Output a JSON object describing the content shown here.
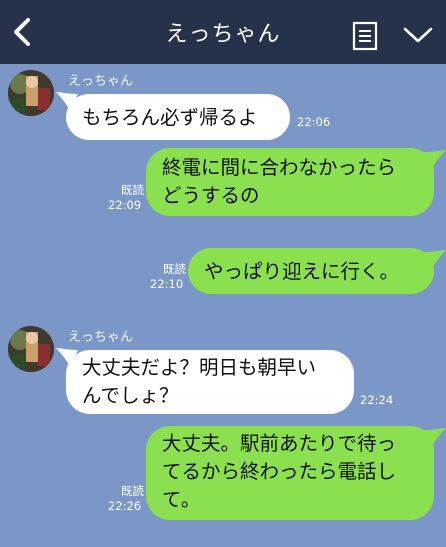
{
  "header": {
    "title": "えっちゃん",
    "back_icon": "chevron-left-icon",
    "note_icon": "notes-icon",
    "menu_icon": "chevron-down-icon",
    "background": "#263249"
  },
  "chat": {
    "background": "#7b97c7",
    "incoming_bubble_color": "#ffffff",
    "outgoing_bubble_color": "#8ae04f"
  },
  "messages": [
    {
      "direction": "in",
      "sender": "えっちゃん",
      "text": "もちろん必ず帰るよ",
      "time": "22:06"
    },
    {
      "direction": "out",
      "read": "既読",
      "text": "終電に間に合わなかったら\nどうするの",
      "time": "22:09"
    },
    {
      "direction": "out",
      "read": "既読",
      "text": "やっぱり迎えに行く。",
      "time": "22:10"
    },
    {
      "direction": "in",
      "sender": "えっちゃん",
      "text": "大丈夫だよ？明日も朝早い\nんでしょ？",
      "time": "22:24"
    },
    {
      "direction": "out",
      "read": "既読",
      "text": "大丈夫。駅前あたりで待っ\nてるから終わったら電話し\nて。",
      "time": "22:26"
    }
  ]
}
